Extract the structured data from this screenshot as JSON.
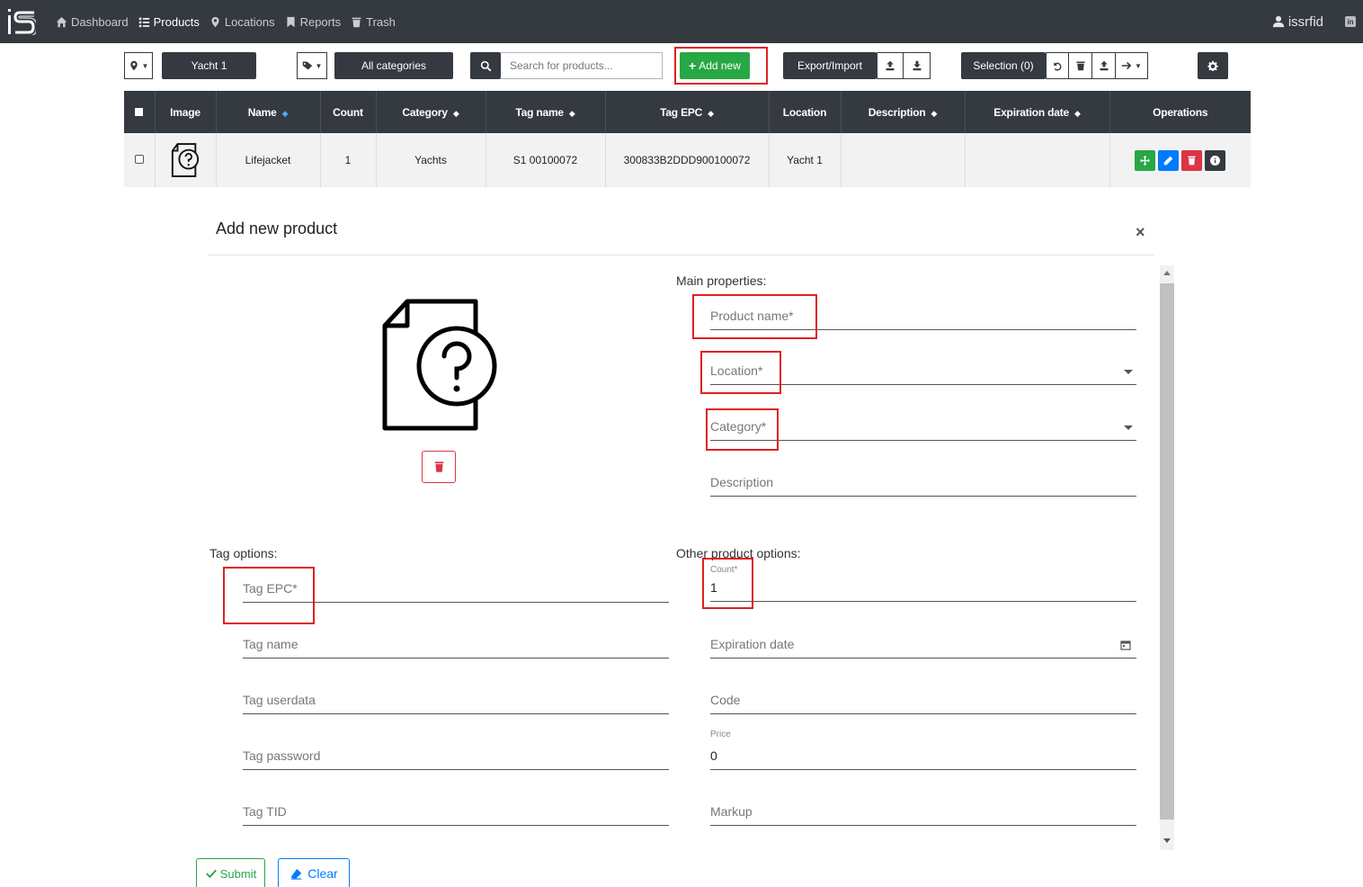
{
  "nav": {
    "links": [
      {
        "label": "Dashboard",
        "icon": "home-icon"
      },
      {
        "label": "Products",
        "icon": "list-icon"
      },
      {
        "label": "Locations",
        "icon": "map-marker-icon"
      },
      {
        "label": "Reports",
        "icon": "bookmark-icon"
      },
      {
        "label": "Trash",
        "icon": "trash-icon"
      }
    ],
    "user": "issrfid"
  },
  "toolbar": {
    "location_value": "Yacht 1",
    "category_value": "All categories",
    "search_placeholder": "Search for products...",
    "add_new_label": "Add new",
    "export_import_label": "Export/Import",
    "selection_label": "Selection (0)"
  },
  "table": {
    "headers": [
      "Image",
      "Name",
      "Count",
      "Category",
      "Tag name",
      "Tag EPC",
      "Location",
      "Description",
      "Expiration date",
      "Operations"
    ],
    "rows": [
      {
        "name": "Lifejacket",
        "count": "1",
        "category": "Yachts",
        "tag_name": "S1 00100072",
        "tag_epc": "300833B2DDD900100072",
        "location": "Yacht 1",
        "description": "",
        "expiration": ""
      }
    ]
  },
  "modal": {
    "title": "Add new product",
    "close": "×",
    "main_properties_label": "Main properties:",
    "tag_options_label": "Tag options:",
    "other_options_label": "Other product options:",
    "fields": {
      "product_name": "Product name*",
      "location": "Location*",
      "category": "Category*",
      "description": "Description",
      "tag_epc": "Tag EPC*",
      "tag_name": "Tag name",
      "tag_userdata": "Tag userdata",
      "tag_password": "Tag password",
      "tag_tid": "Tag TID",
      "count_label": "Count*",
      "count_value": "1",
      "expiration_date": "Expiration date",
      "code": "Code",
      "price_label": "Price",
      "price_value": "0",
      "markup": "Markup"
    },
    "submit_label": "Submit",
    "clear_label": "Clear"
  },
  "colors": {
    "navbar": "#343a40",
    "add_new": "#28a745",
    "highlight": "#e02020",
    "delete": "#dc3545",
    "edit": "#007bff"
  }
}
